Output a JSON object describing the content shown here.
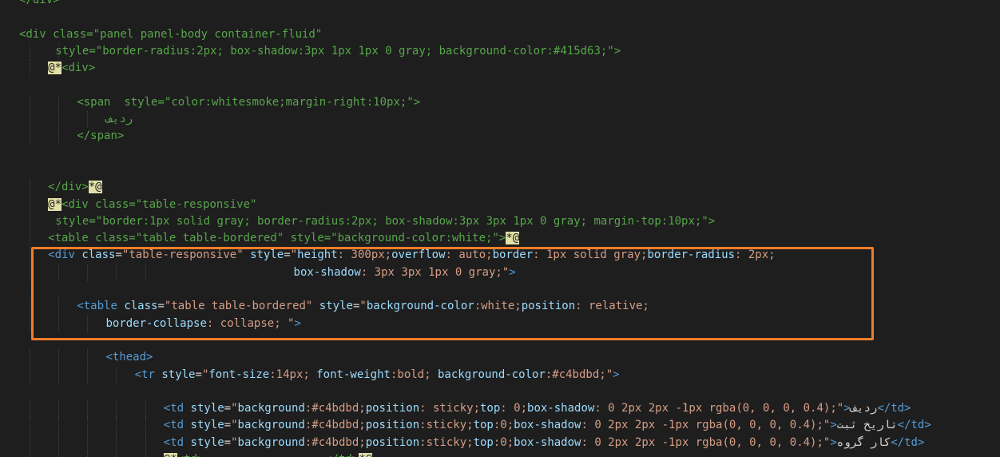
{
  "editor": {
    "accent_color": "#f07d2a",
    "lines": [
      {
        "indent": 0,
        "segments": [
          {
            "c": "com",
            "t": "</div>"
          }
        ]
      },
      {
        "indent": 0,
        "segments": []
      },
      {
        "indent": 0,
        "segments": [
          {
            "c": "com",
            "t": "<div class=\"panel panel-body container-fluid\""
          }
        ]
      },
      {
        "indent": 5,
        "segments": [
          {
            "c": "com",
            "t": "style=\"border-radius:2px; box-shadow:3px 1px 1px 0 gray; background-color:#415d63;\">"
          }
        ]
      },
      {
        "indent": 4,
        "segments": [
          {
            "c": "at",
            "t": "@*"
          },
          {
            "c": "com",
            "t": "<div>"
          }
        ]
      },
      {
        "indent": 0,
        "segments": []
      },
      {
        "indent": 8,
        "segments": [
          {
            "c": "com",
            "t": "<span  style=\"color:whitesmoke;margin-right:10px;\">"
          }
        ]
      },
      {
        "indent": 12,
        "segments": [
          {
            "c": "com",
            "t": "ردیف"
          }
        ]
      },
      {
        "indent": 8,
        "segments": [
          {
            "c": "com",
            "t": "</span>"
          }
        ]
      },
      {
        "indent": 0,
        "segments": []
      },
      {
        "indent": 0,
        "segments": []
      },
      {
        "indent": 4,
        "segments": [
          {
            "c": "com",
            "t": "</div>"
          },
          {
            "c": "at",
            "t": "*@"
          }
        ]
      },
      {
        "indent": 4,
        "segments": [
          {
            "c": "at",
            "t": "@*"
          },
          {
            "c": "com",
            "t": "<div class=\"table-responsive\""
          }
        ]
      },
      {
        "indent": 5,
        "segments": [
          {
            "c": "com",
            "t": "style=\"border:1px solid gray; border-radius:2px; box-shadow:3px 3px 1px 0 gray; margin-top:10px;\">"
          }
        ]
      },
      {
        "indent": 4,
        "segments": [
          {
            "c": "com",
            "t": "<table class=\"table table-bordered\" style=\"background-color:white;\">"
          },
          {
            "c": "at",
            "t": "*@"
          }
        ]
      },
      {
        "indent": 4,
        "segments": [
          {
            "c": "tag",
            "t": "<div "
          },
          {
            "c": "attr",
            "t": "class"
          },
          {
            "c": "txt",
            "t": "="
          },
          {
            "c": "str",
            "t": "\"table-responsive\""
          },
          {
            "c": "txt",
            "t": " "
          },
          {
            "c": "attr",
            "t": "style"
          },
          {
            "c": "txt",
            "t": "="
          },
          {
            "c": "str",
            "t": "\""
          },
          {
            "c": "attr",
            "t": "height"
          },
          {
            "c": "str",
            "t": ": 300px;"
          },
          {
            "c": "attr",
            "t": "overflow"
          },
          {
            "c": "str",
            "t": ": auto;"
          },
          {
            "c": "attr",
            "t": "border"
          },
          {
            "c": "str",
            "t": ": 1px solid gray;"
          },
          {
            "c": "attr",
            "t": "border-radius"
          },
          {
            "c": "str",
            "t": ": 2px;"
          }
        ]
      },
      {
        "indent": 38,
        "segments": [
          {
            "c": "attr",
            "t": "box-shadow"
          },
          {
            "c": "str",
            "t": ": 3px 3px 1px 0 gray;\""
          },
          {
            "c": "tag",
            "t": ">"
          }
        ]
      },
      {
        "indent": 0,
        "segments": []
      },
      {
        "indent": 8,
        "segments": [
          {
            "c": "tag",
            "t": "<table "
          },
          {
            "c": "attr",
            "t": "class"
          },
          {
            "c": "txt",
            "t": "="
          },
          {
            "c": "str",
            "t": "\"table table-bordered\""
          },
          {
            "c": "txt",
            "t": " "
          },
          {
            "c": "attr",
            "t": "style"
          },
          {
            "c": "txt",
            "t": "="
          },
          {
            "c": "str",
            "t": "\""
          },
          {
            "c": "attr",
            "t": "background-color"
          },
          {
            "c": "str",
            "t": ":white;"
          },
          {
            "c": "attr",
            "t": "position"
          },
          {
            "c": "str",
            "t": ": relative;"
          }
        ]
      },
      {
        "indent": 12,
        "segments": [
          {
            "c": "attr",
            "t": "border-collapse"
          },
          {
            "c": "str",
            "t": ": collapse; \""
          },
          {
            "c": "tag",
            "t": ">"
          }
        ]
      },
      {
        "indent": 0,
        "segments": []
      },
      {
        "indent": 12,
        "segments": [
          {
            "c": "tag",
            "t": "<thead>"
          }
        ]
      },
      {
        "indent": 16,
        "segments": [
          {
            "c": "tag",
            "t": "<tr "
          },
          {
            "c": "attr",
            "t": "style"
          },
          {
            "c": "txt",
            "t": "="
          },
          {
            "c": "str",
            "t": "\""
          },
          {
            "c": "attr",
            "t": "font-size"
          },
          {
            "c": "str",
            "t": ":14px; "
          },
          {
            "c": "attr",
            "t": "font-weight"
          },
          {
            "c": "str",
            "t": ":bold; "
          },
          {
            "c": "attr",
            "t": "background-color"
          },
          {
            "c": "str",
            "t": ":#c4bdbd;\""
          },
          {
            "c": "tag",
            "t": ">"
          }
        ]
      },
      {
        "indent": 0,
        "segments": []
      },
      {
        "indent": 20,
        "segments": [
          {
            "c": "tag",
            "t": "<td "
          },
          {
            "c": "attr",
            "t": "style"
          },
          {
            "c": "txt",
            "t": "="
          },
          {
            "c": "str",
            "t": "\""
          },
          {
            "c": "attr",
            "t": "background"
          },
          {
            "c": "str",
            "t": ":#c4bdbd;"
          },
          {
            "c": "attr",
            "t": "position"
          },
          {
            "c": "str",
            "t": ": sticky;"
          },
          {
            "c": "attr",
            "t": "top"
          },
          {
            "c": "str",
            "t": ": 0;"
          },
          {
            "c": "attr",
            "t": "box-shadow"
          },
          {
            "c": "str",
            "t": ": 0 2px 2px -1px rgba(0, 0, 0, 0.4);\""
          },
          {
            "c": "tag",
            "t": ">"
          },
          {
            "c": "txt",
            "t": "ردیف"
          },
          {
            "c": "tag",
            "t": "</td>"
          }
        ]
      },
      {
        "indent": 20,
        "segments": [
          {
            "c": "tag",
            "t": "<td "
          },
          {
            "c": "attr",
            "t": "style"
          },
          {
            "c": "txt",
            "t": "="
          },
          {
            "c": "str",
            "t": "\""
          },
          {
            "c": "attr",
            "t": "background"
          },
          {
            "c": "str",
            "t": ":#c4bdbd;"
          },
          {
            "c": "attr",
            "t": "position"
          },
          {
            "c": "str",
            "t": ":sticky;"
          },
          {
            "c": "attr",
            "t": "top"
          },
          {
            "c": "str",
            "t": ":0;"
          },
          {
            "c": "attr",
            "t": "box-shadow"
          },
          {
            "c": "str",
            "t": ": 0 2px 2px -1px rgba(0, 0, 0, 0.4);\""
          },
          {
            "c": "tag",
            "t": ">"
          },
          {
            "c": "txt",
            "t": "تاریخ ثبت"
          },
          {
            "c": "tag",
            "t": "</td>"
          }
        ]
      },
      {
        "indent": 20,
        "segments": [
          {
            "c": "tag",
            "t": "<td "
          },
          {
            "c": "attr",
            "t": "style"
          },
          {
            "c": "txt",
            "t": "="
          },
          {
            "c": "str",
            "t": "\""
          },
          {
            "c": "attr",
            "t": "background"
          },
          {
            "c": "str",
            "t": ":#c4bdbd;"
          },
          {
            "c": "attr",
            "t": "position"
          },
          {
            "c": "str",
            "t": ":sticky;"
          },
          {
            "c": "attr",
            "t": "top"
          },
          {
            "c": "str",
            "t": ":0;"
          },
          {
            "c": "attr",
            "t": "box-shadow"
          },
          {
            "c": "str",
            "t": ": 0 2px 2px -1px rgba(0, 0, 0, 0.4);\""
          },
          {
            "c": "tag",
            "t": ">"
          },
          {
            "c": "txt",
            "t": "کار گروه"
          },
          {
            "c": "tag",
            "t": "</td>"
          }
        ]
      },
      {
        "indent": 20,
        "segments": [
          {
            "c": "at",
            "t": "@*"
          },
          {
            "c": "com",
            "t": "<td>                  </td>"
          },
          {
            "c": "at",
            "t": "*@"
          }
        ]
      }
    ]
  }
}
